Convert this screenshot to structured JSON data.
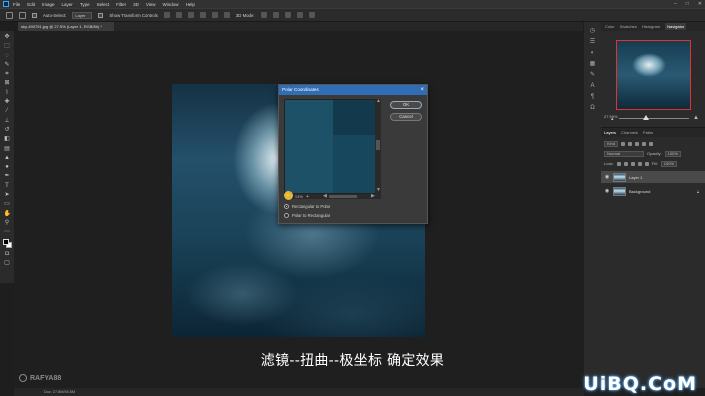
{
  "menubar": {
    "items": [
      "File",
      "Edit",
      "Image",
      "Layer",
      "Type",
      "Select",
      "Filter",
      "3D",
      "View",
      "Window",
      "Help"
    ],
    "window_controls": [
      "–",
      "□",
      "✕"
    ]
  },
  "options_bar": {
    "auto_select_label": "Auto-Select:",
    "auto_select_value": "Layer",
    "show_transform_label": "Show Transform Controls",
    "mode_3d_label": "3D Mode:"
  },
  "document": {
    "tab_title": "sky-490791.jpg @ 27.5% (Layer 1, RGB/8#) *"
  },
  "dialog": {
    "title": "Polar Coordinates",
    "close": "×",
    "ok_label": "OK",
    "cancel_label": "Cancel",
    "zoom_value": "13%",
    "option_rect_to_polar": "Rectangular to Polar",
    "option_polar_to_rect": "Polar to Rectangular",
    "selected_option": "Rectangular to Polar"
  },
  "panels": {
    "top_tabs": [
      "Color",
      "Swatches",
      "Histogram",
      "Navigator"
    ],
    "active_top_tab": "Navigator",
    "nav_zoom": "27.59%",
    "layer_tabs": [
      "Layers",
      "Channels",
      "Paths"
    ],
    "active_layer_tab": "Layers",
    "filter_kind": "Kind",
    "blend_mode": "Normal",
    "opacity_label": "Opacity:",
    "opacity_value": "100%",
    "lock_label": "Lock:",
    "fill_label": "Fill:",
    "fill_value": "100%",
    "layers": [
      {
        "name": "Layer 1",
        "selected": true
      },
      {
        "name": "Background",
        "selected": false
      }
    ]
  },
  "status": {
    "doc_info": "Doc: 27.8M/55.6M"
  },
  "overlay": {
    "subtitle": "滤镜--扭曲--极坐标 确定效果",
    "watermark_left": "RAFYA88",
    "watermark_right": "UiBQ.CoM"
  }
}
